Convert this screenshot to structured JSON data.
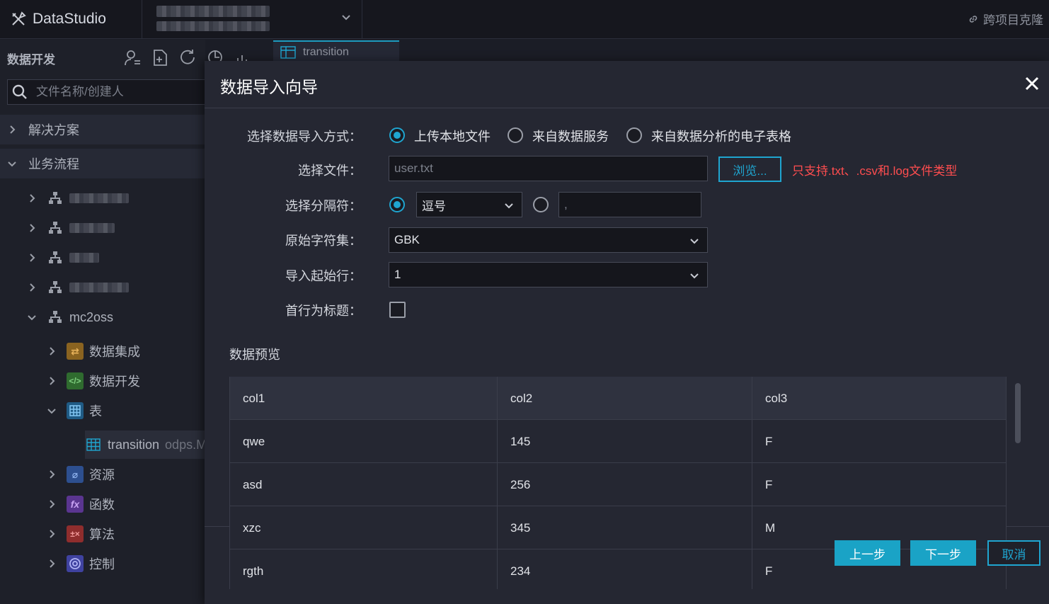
{
  "app": {
    "name": "DataStudio",
    "cross_project_clone": "跨项目克隆"
  },
  "sidebar": {
    "title": "数据开发",
    "search_placeholder": "文件名称/创建人",
    "sections": [
      "解决方案",
      "业务流程"
    ],
    "workflows": [
      {
        "name": "mc2oss"
      }
    ],
    "children": [
      {
        "label": "数据集成",
        "icon": "data-integration-icon",
        "color": "#c98a2e"
      },
      {
        "label": "数据开发",
        "icon": "code-icon",
        "color": "#3c9d3c"
      },
      {
        "label": "表",
        "icon": "table-icon",
        "color": "#2b7fb8"
      },
      {
        "label": "资源",
        "icon": "resource-icon",
        "color": "#3a6fd0"
      },
      {
        "label": "函数",
        "icon": "function-icon",
        "color": "#7d4bc2"
      },
      {
        "label": "算法",
        "icon": "algorithm-icon",
        "color": "#c23a3a"
      },
      {
        "label": "控制",
        "icon": "control-icon",
        "color": "#5b5fd6"
      }
    ],
    "table_item": {
      "name": "transition",
      "type": "odps.M"
    }
  },
  "editor_tab": {
    "label": "transition"
  },
  "dialog": {
    "title": "数据导入向导",
    "import_method_label": "选择数据导入方式：",
    "import_methods": [
      "上传本地文件",
      "来自数据服务",
      "来自数据分析的电子表格"
    ],
    "file_label": "选择文件：",
    "file_value": "user.txt",
    "browse_label": "浏览...",
    "file_hint": "只支持.txt、.csv和.log文件类型",
    "delimiter_label": "选择分隔符：",
    "delimiter_value": "逗号",
    "custom_delimiter_value": ",",
    "charset_label": "原始字符集：",
    "charset_value": "GBK",
    "start_row_label": "导入起始行：",
    "start_row_value": "1",
    "header_label": "首行为标题：",
    "preview_title": "数据预览",
    "table": {
      "columns": [
        "col1",
        "col2",
        "col3"
      ],
      "rows": [
        [
          "qwe",
          "145",
          "F"
        ],
        [
          "asd",
          "256",
          "F"
        ],
        [
          "xzc",
          "345",
          "M"
        ],
        [
          "rgth",
          "234",
          "F"
        ]
      ]
    },
    "buttons": {
      "prev": "上一步",
      "next": "下一步",
      "cancel": "取消"
    }
  },
  "colors": {
    "accent": "#1fa5d0",
    "danger": "#ff4d4f",
    "background": "#1b1d26"
  }
}
